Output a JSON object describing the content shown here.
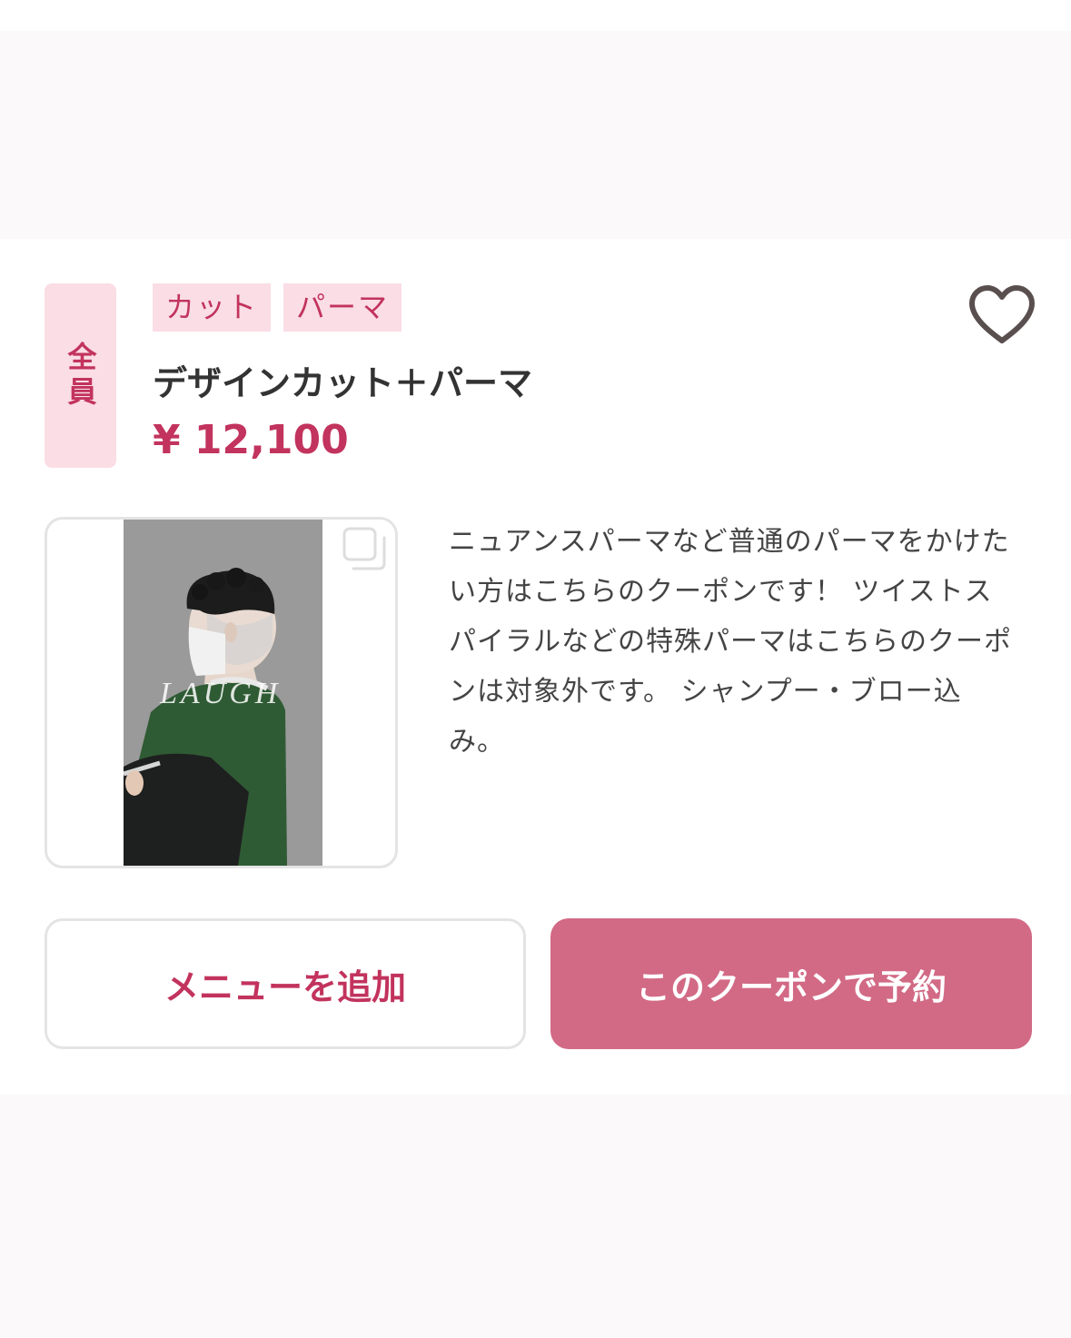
{
  "coupon": {
    "target": "全員",
    "tags": [
      "カット",
      "パーマ"
    ],
    "title": "デザインカット＋パーマ",
    "price": "¥ 12,100",
    "watermark": "LAUGH",
    "description": "ニュアンスパーマなど普通のパーマをかけたい方はこちらのクーポンです！ ツイストスパイラルなどの特殊パーマはこちらのクーポンは対象外です。 シャンプー・ブロー込み。",
    "favorite_icon": "heart-outline-icon",
    "gallery_icon": "multiple-images-icon"
  },
  "actions": {
    "add_menu_label": "メニューを追加",
    "book_label": "このクーポンで予約"
  },
  "colors": {
    "accent": "#c2335d",
    "tag_bg": "#fadde5",
    "primary_button": "#d26a85",
    "text": "#333333"
  }
}
